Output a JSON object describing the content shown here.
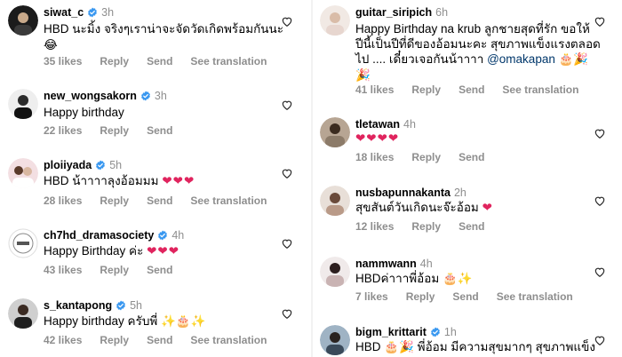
{
  "left": [
    {
      "username": "siwat_c",
      "verified": true,
      "time": "3h",
      "text": "HBD นะมิ้ง จริงๆเราน่าจะจัดวัดเกิดพร้อมกันนะ",
      "text2": "😂",
      "likes": "35 likes",
      "reply": "Reply",
      "send": "Send",
      "translate": "See translation"
    },
    {
      "username": "new_wongsakorn",
      "verified": true,
      "time": "3h",
      "text": "Happy birthday",
      "likes": "22 likes",
      "reply": "Reply",
      "send": "Send"
    },
    {
      "username": "ploiiyada",
      "verified": true,
      "time": "5h",
      "text": "HBD น้าาาาลุงอ้อมมม",
      "hearts": "❤❤❤",
      "likes": "28 likes",
      "reply": "Reply",
      "send": "Send",
      "translate": "See translation"
    },
    {
      "username": "ch7hd_dramasociety",
      "verified": true,
      "time": "4h",
      "text": "Happy Birthday ค่ะ",
      "hearts": "❤❤❤",
      "likes": "43 likes",
      "reply": "Reply",
      "send": "Send"
    },
    {
      "username": "s_kantapong",
      "verified": true,
      "time": "5h",
      "text": "Happy birthday ครับพี่",
      "emojis": "✨🎂✨",
      "likes": "42 likes",
      "reply": "Reply",
      "send": "Send",
      "translate": "See translation"
    }
  ],
  "right": [
    {
      "username": "guitar_siripich",
      "verified": false,
      "time": "6h",
      "line1": "Happy Birthday na krub ลูกชายสุดที่รัก ขอให้",
      "line2": "ปีนี้เป็นปีที่ดีของอ้อมนะคะ สุขภาพแข็งแรงตลอด",
      "line3a": "ไป .... เดี๋ยวเจอกันน้าาาา",
      "mention": "@omakapan",
      "line3b": "🎂🎉",
      "line4": "🎉",
      "likes": "41 likes",
      "reply": "Reply",
      "send": "Send",
      "translate": "See translation"
    },
    {
      "username": "tletawan",
      "verified": false,
      "time": "4h",
      "hearts": "❤❤❤❤",
      "likes": "18 likes",
      "reply": "Reply",
      "send": "Send"
    },
    {
      "username": "nusbapunnakanta",
      "verified": false,
      "time": "2h",
      "text": "สุขสันต์วันเกิดนะจ๊ะอ้อม",
      "hearts": "❤",
      "likes": "12 likes",
      "reply": "Reply",
      "send": "Send"
    },
    {
      "username": "nammwann",
      "verified": false,
      "time": "4h",
      "text": "HBDค่าาาพี่อ้อม",
      "emojis": "🎂✨",
      "likes": "7 likes",
      "reply": "Reply",
      "send": "Send",
      "translate": "See translation"
    },
    {
      "username": "bigm_krittarit",
      "verified": true,
      "time": "1h",
      "text": "HBD",
      "emojis": "🎂🎉",
      "text2": "พี่อ้อม มีความสุขมากๆ สุขภาพแข็ง"
    }
  ],
  "colors": {
    "verified": "#3897f0",
    "heart": "#e0245e",
    "muted": "#8e8e8e",
    "mention": "#00376b"
  },
  "icons": {
    "like": "heart-outline-icon",
    "verified": "verified-badge-icon"
  }
}
